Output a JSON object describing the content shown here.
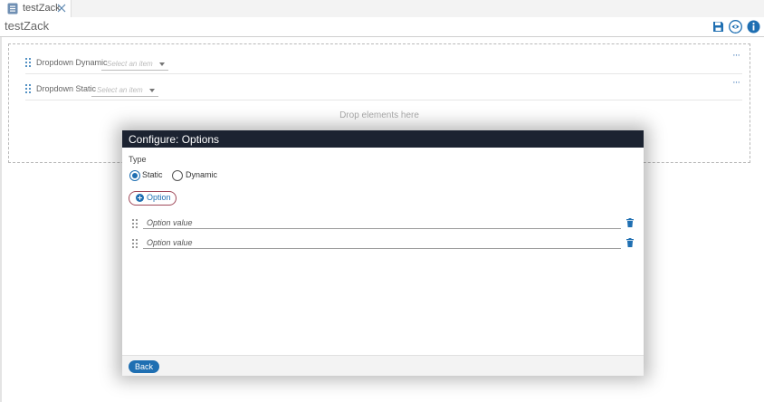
{
  "tabs": [
    {
      "label": "testZack"
    }
  ],
  "header": {
    "title": "testZack"
  },
  "canvas": {
    "fields": [
      {
        "label": "Dropdown Dynamic",
        "placeholder": "Select an item"
      },
      {
        "label": "Dropdown Static",
        "placeholder": "Select an item"
      }
    ],
    "more_label": "···",
    "drop_hint": "Drop elements here"
  },
  "modal": {
    "title": "Configure: Options",
    "type_label": "Type",
    "radios": [
      {
        "label": "Static",
        "checked": true
      },
      {
        "label": "Dynamic",
        "checked": false
      }
    ],
    "add_option_label": "Option",
    "options": [
      {
        "value": "",
        "placeholder": "Option value"
      },
      {
        "value": "",
        "placeholder": "Option value"
      }
    ],
    "back_label": "Back"
  },
  "icons": [
    "document-icon",
    "close-icon",
    "save-icon",
    "eye-icon",
    "info-icon",
    "drag-handle-icon",
    "plus-icon",
    "trash-icon"
  ],
  "colors": {
    "accent": "#1f6fb2",
    "modal_header": "#1c2331",
    "option_border": "#a04a5a"
  }
}
